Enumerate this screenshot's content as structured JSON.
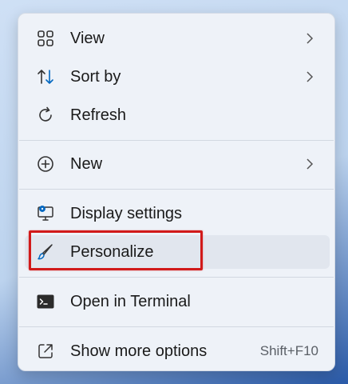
{
  "menu": {
    "items": [
      {
        "label": "View",
        "icon": "grid-icon",
        "has_submenu": true
      },
      {
        "label": "Sort by",
        "icon": "sort-icon",
        "has_submenu": true
      },
      {
        "label": "Refresh",
        "icon": "refresh-icon",
        "has_submenu": false
      },
      {
        "label": "New",
        "icon": "plus-circle-icon",
        "has_submenu": true
      },
      {
        "label": "Display settings",
        "icon": "display-settings-icon",
        "has_submenu": false
      },
      {
        "label": "Personalize",
        "icon": "brush-icon",
        "has_submenu": false,
        "hovered": true
      },
      {
        "label": "Open in Terminal",
        "icon": "terminal-icon",
        "has_submenu": false
      },
      {
        "label": "Show more options",
        "icon": "open-external-icon",
        "shortcut": "Shift+F10"
      }
    ]
  },
  "colors": {
    "highlight_border": "#d11a1a",
    "accent": "#0067c0"
  }
}
